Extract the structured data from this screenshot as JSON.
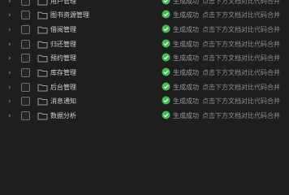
{
  "tree": {
    "rows": [
      {
        "label": "用户管理",
        "status": "生成成功",
        "hint": "点击下方文档",
        "compare": "对比代码合并"
      },
      {
        "label": "图书资源管理",
        "status": "生成成功",
        "hint": "点击下方文档",
        "compare": "对比代码合并"
      },
      {
        "label": "借阅管理",
        "status": "生成成功",
        "hint": "点击下方文档",
        "compare": "对比代码合并"
      },
      {
        "label": "归还管理",
        "status": "生成成功",
        "hint": "点击下方文档",
        "compare": "对比代码合并"
      },
      {
        "label": "预约管理",
        "status": "生成成功",
        "hint": "点击下方文档",
        "compare": "对比代码合并"
      },
      {
        "label": "库存管理",
        "status": "生成成功",
        "hint": "点击下方文档",
        "compare": "对比代码合并"
      },
      {
        "label": "后台管理",
        "status": "生成成功",
        "hint": "点击下方文档",
        "compare": "对比代码合并"
      },
      {
        "label": "消息通知",
        "status": "生成成功",
        "hint": "点击下方文档",
        "compare": "对比代码合并"
      },
      {
        "label": "数据分析",
        "status": "生成成功",
        "hint": "点击下方文档",
        "compare": "对比代码合并"
      }
    ]
  },
  "colors": {
    "background": "#1e1e1f",
    "success": "#3fbf4f",
    "folder": "#9a9a9a"
  },
  "icons": {
    "expand": "chevron-right-icon",
    "folder": "folder-icon",
    "status": "check-circle-icon"
  }
}
